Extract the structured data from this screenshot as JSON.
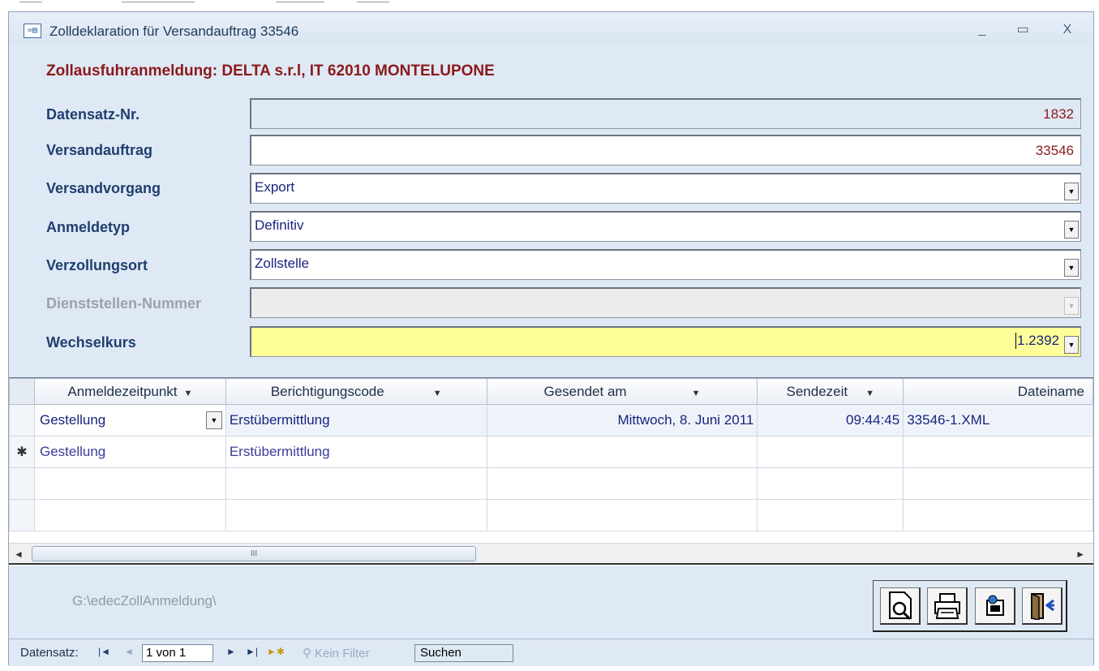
{
  "window": {
    "title": "Zolldeklaration für Versandauftrag 33546",
    "minimize": "_",
    "maximize": "▭",
    "close": "X",
    "icon": "form-icon"
  },
  "form": {
    "heading": "Zollausfuhranmeldung: DELTA  s.r.l,  IT 62010  MONTELUPONE",
    "fields": {
      "datensatz_label": "Datensatz-Nr.",
      "datensatz_value": "1832",
      "versandauftrag_label": "Versandauftrag",
      "versandauftrag_value": "33546",
      "versandvorgang_label": "Versandvorgang",
      "versandvorgang_value": "Export",
      "anmeldetyp_label": "Anmeldetyp",
      "anmeldetyp_value": "Definitiv",
      "verzollungsort_label": "Verzollungsort",
      "verzollungsort_value": "Zollstelle",
      "dienststellen_label": "Dienststellen-Nummer",
      "dienststellen_value": "",
      "wechselkurs_label": "Wechselkurs",
      "wechselkurs_value": "1.2392"
    }
  },
  "grid": {
    "columns": [
      "Anmeldezeitpunkt",
      "Berichtigungscode",
      "Gesendet am",
      "Sendezeit",
      "Dateiname"
    ],
    "rows": [
      [
        "Gestellung",
        "Erstübermittlung",
        "Mittwoch, 8. Juni 2011",
        "09:44:45",
        "33546-1.XML"
      ]
    ],
    "new_row": [
      "Gestellung",
      "Erstübermittlung"
    ],
    "new_row_marker": "✱",
    "scroll_thumb": "III"
  },
  "footer": {
    "path": "G:\\edecZollAnmeldung\\",
    "buttons": [
      "preview-icon",
      "print-icon",
      "export-icon",
      "exit-icon"
    ]
  },
  "statusbar": {
    "label": "Datensatz:",
    "first": "|◄",
    "prev": "◄",
    "record": "1 von 1",
    "next": "►",
    "last": "►|",
    "new": "►✱",
    "filter": "Kein Filter",
    "search": "Suchen"
  }
}
